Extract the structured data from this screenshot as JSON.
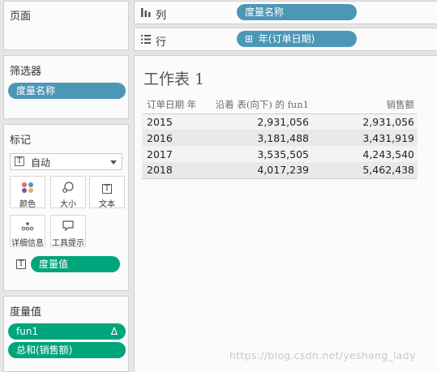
{
  "pages": {
    "title": "页面"
  },
  "filters": {
    "title": "筛选器",
    "pill": "度量名称"
  },
  "marks": {
    "title": "标记",
    "type_icon": "T",
    "type": "自动",
    "buttons": {
      "color": "颜色",
      "size": "大小",
      "text": "文本",
      "detail": "详细信息",
      "tooltip": "工具提示"
    },
    "text_pill": "度量值"
  },
  "measure_values": {
    "title": "度量值",
    "items": [
      {
        "label": "fun1",
        "badge": "Δ"
      },
      {
        "label": "总和(销售额)"
      }
    ]
  },
  "columns": {
    "icon": "iii",
    "label": "列",
    "pill": "度量名称"
  },
  "rows": {
    "icon": "☰",
    "label": "行",
    "pill_icon": "⊞",
    "pill": "年(订单日期)"
  },
  "sheet": {
    "title": "工作表 1",
    "headers": [
      "订单日期 年",
      "沿着 表(向下) 的 fun1",
      "销售额"
    ],
    "rows": [
      [
        "2015",
        "2,931,056",
        "2,931,056"
      ],
      [
        "2016",
        "3,181,488",
        "3,431,919"
      ],
      [
        "2017",
        "3,535,505",
        "4,243,540"
      ],
      [
        "2018",
        "4,017,239",
        "5,462,438"
      ]
    ]
  },
  "watermark": "https://blog.csdn.net/yeshang_lady",
  "colors": {
    "pill_blue": "#4d97b6",
    "pill_green": "#00a57c",
    "panel_bg": "#fbfbfb",
    "app_bg": "#e6e6e6"
  }
}
